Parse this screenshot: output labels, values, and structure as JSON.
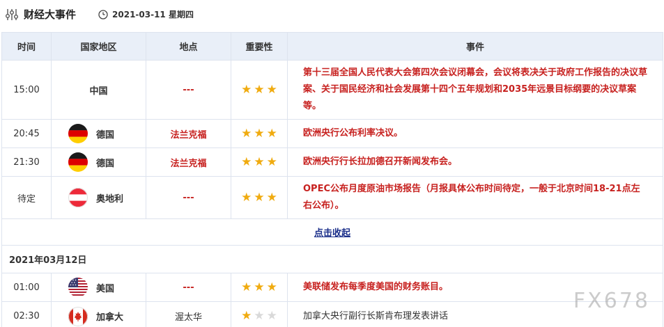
{
  "header": {
    "icon": "filter-sliders-icon",
    "title": "财经大事件",
    "date_icon": "clock-icon",
    "date": "2021-03-11 星期四"
  },
  "columns": [
    "时间",
    "国家地区",
    "地点",
    "重要性",
    "事件"
  ],
  "rows": [
    {
      "time": "15:00",
      "country": "中国",
      "flag": null,
      "place": "---",
      "place_style": "red",
      "stars": 3,
      "event": "第十三届全国人民代表大会第四次会议闭幕会，会议将表决关于政府工作报告的决议草案、关于国民经济和社会发展第十四个五年规划和2035年远景目标纲要的决议草案等。",
      "event_style": "red"
    },
    {
      "time": "20:45",
      "country": "德国",
      "flag": "de",
      "place": "法兰克福",
      "place_style": "red",
      "stars": 3,
      "event": "欧洲央行公布利率决议。",
      "event_style": "red"
    },
    {
      "time": "21:30",
      "country": "德国",
      "flag": "de",
      "place": "法兰克福",
      "place_style": "red",
      "stars": 3,
      "event": "欧洲央行行长拉加德召开新闻发布会。",
      "event_style": "red"
    },
    {
      "time": "待定",
      "country": "奥地利",
      "flag": "at",
      "place": "---",
      "place_style": "red",
      "stars": 3,
      "event": "OPEC公布月度原油市场报告（月报具体公布时间待定，一般于北京时间18-21点左右公布）。",
      "event_style": "red"
    }
  ],
  "collapse_label": "点击收起",
  "date_section": "2021年03月12日",
  "rows2": [
    {
      "time": "01:00",
      "country": "美国",
      "flag": "us",
      "place": "---",
      "place_style": "red",
      "stars": 3,
      "event": "美联储发布每季度美国的财务账目。",
      "event_style": "red"
    },
    {
      "time": "02:30",
      "country": "加拿大",
      "flag": "ca",
      "place": "渥太华",
      "place_style": "normal",
      "stars": 1,
      "event": "加拿大央行副行长斯肯布理发表讲话",
      "event_style": "normal"
    }
  ],
  "max_stars": 3,
  "colors": {
    "header_bg": "#e9eff8",
    "accent_red": "#c7211f",
    "star": "#f0ab10",
    "star_off": "#d9d9d9",
    "link": "#1a2e8a"
  },
  "watermark": "FX678"
}
